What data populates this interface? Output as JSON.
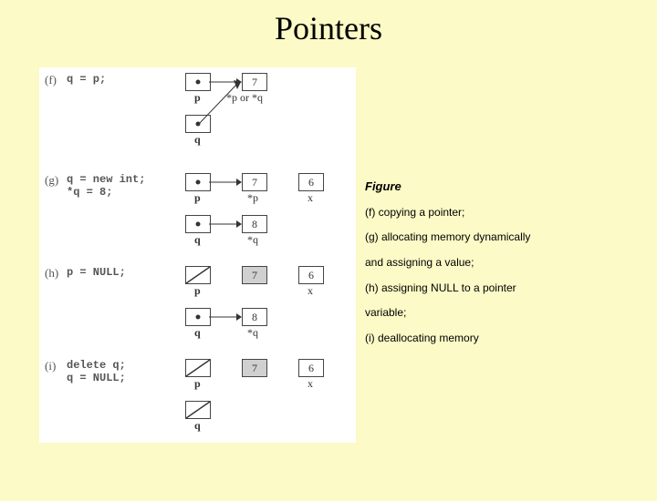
{
  "title": "Pointers",
  "caption": {
    "figure": "Figure",
    "f": "(f) copying a pointer;",
    "g": "(g) allocating memory dynamically",
    "g2": "and assigning a value;",
    "h": "(h) assigning NULL to a pointer",
    "h2": "variable;",
    "i": "(i) deallocating memory"
  },
  "panels": {
    "f": {
      "tag": "(f)",
      "code": "q = p;"
    },
    "g": {
      "tag": "(g)",
      "code1": "q = new int;",
      "code2": "*q = 8;"
    },
    "h": {
      "tag": "(h)",
      "code": "p = NULL;"
    },
    "i": {
      "tag": "(i)",
      "code1": "delete q;",
      "code2": "q = NULL;"
    }
  },
  "labels": {
    "p": "p",
    "q": "q",
    "x": "x",
    "star_p": "*p",
    "star_q": "*q",
    "star_p_or_q": "*p or *q"
  },
  "values": {
    "seven": "7",
    "eight": "8",
    "six": "6"
  }
}
